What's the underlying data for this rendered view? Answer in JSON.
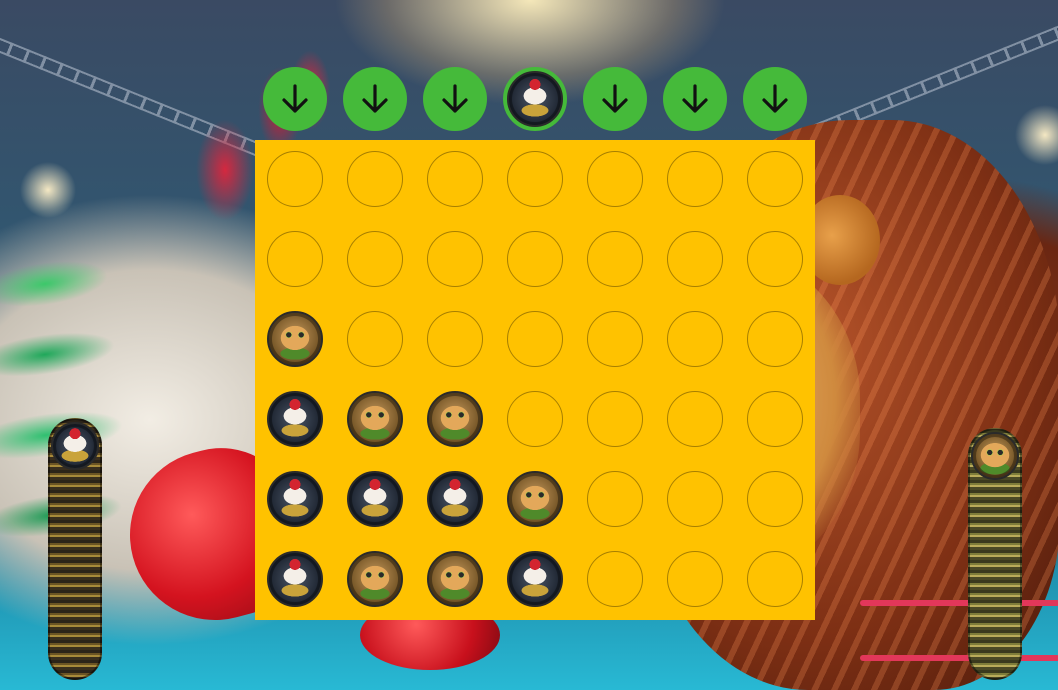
{
  "game": {
    "columns": 7,
    "rows": 6,
    "colors": {
      "board": "#ffc200",
      "drop_button": "#45ba3a",
      "arrow": "#111111"
    },
    "drop_buttons": [
      {
        "icon": "down-arrow-icon"
      },
      {
        "icon": "down-arrow-icon"
      },
      {
        "icon": "down-arrow-icon"
      },
      {
        "icon": "rooster-token-preview"
      },
      {
        "icon": "down-arrow-icon"
      },
      {
        "icon": "down-arrow-icon"
      },
      {
        "icon": "down-arrow-icon"
      }
    ],
    "board_grid": [
      [
        "empty",
        "empty",
        "empty",
        "empty",
        "empty",
        "empty",
        "empty"
      ],
      [
        "empty",
        "empty",
        "empty",
        "empty",
        "empty",
        "empty",
        "empty"
      ],
      [
        "cat",
        "empty",
        "empty",
        "empty",
        "empty",
        "empty",
        "empty"
      ],
      [
        "rooster",
        "cat",
        "cat",
        "empty",
        "empty",
        "empty",
        "empty"
      ],
      [
        "rooster",
        "rooster",
        "rooster",
        "cat",
        "empty",
        "empty",
        "empty"
      ],
      [
        "rooster",
        "cat",
        "cat",
        "rooster",
        "empty",
        "empty",
        "empty"
      ]
    ],
    "players": {
      "left": {
        "token": "rooster"
      },
      "right": {
        "token": "cat"
      }
    }
  }
}
